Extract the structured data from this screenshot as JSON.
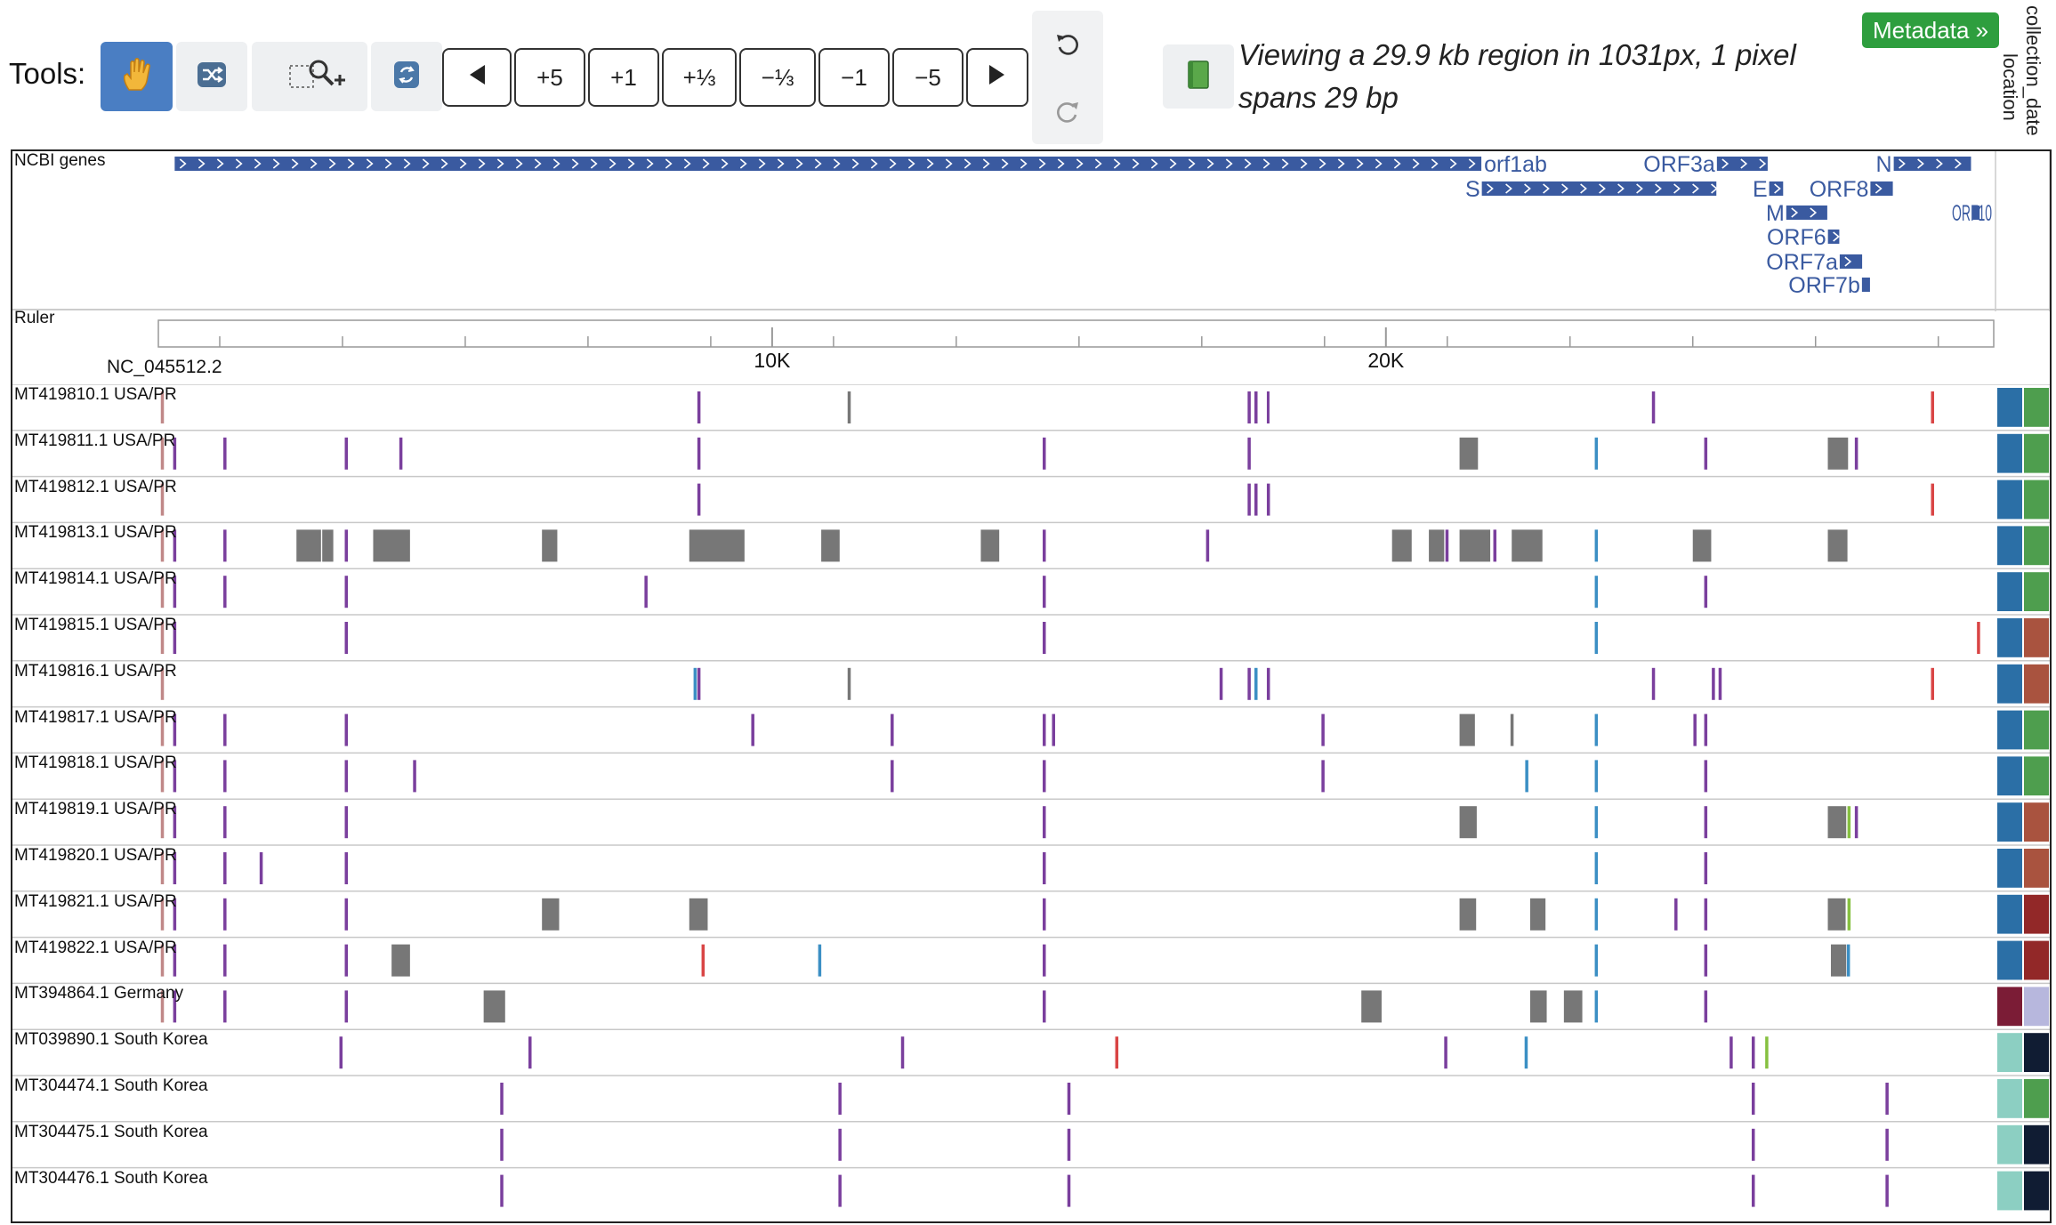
{
  "toolbar": {
    "tools_label": "Tools:",
    "icons": [
      "hand-pan-icon",
      "shuffle-icon",
      "zoom-select-icon",
      "sync-icon"
    ],
    "nav_buttons": [
      "+5",
      "+1",
      "+⅓",
      "−⅓",
      "−1",
      "−5"
    ],
    "view_info": "Viewing a 29.9 kb region in 1031px, 1 pixel spans 29 bp",
    "metadata_button": "Metadata »"
  },
  "metadata_columns": [
    "location",
    "collection_date"
  ],
  "colors": {
    "gene": "#3a5aa0",
    "purple": "#7a3f9d",
    "gray": "#777777",
    "pink": "#c08888",
    "blue": "#3b8fc4",
    "red": "#d94545",
    "green": "#86c040",
    "meta_blue": "#2b6fa6",
    "meta_green": "#4e9e4e",
    "meta_brick": "#a9533f",
    "meta_darkred": "#922828",
    "meta_maroon": "#7b1c36",
    "meta_lavender": "#b7b7dd",
    "meta_teal": "#8ccfc2",
    "meta_navy": "#101c33"
  },
  "genes_track": {
    "label": "NCBI genes",
    "genes": [
      {
        "name": "orf1ab",
        "start": 266,
        "end": 21555,
        "lane": 0
      },
      {
        "name": "ORF3a",
        "start": 25393,
        "end": 26220,
        "lane": 0
      },
      {
        "name": "N",
        "start": 28274,
        "end": 29533,
        "lane": 0
      },
      {
        "name": "S",
        "start": 21563,
        "end": 25384,
        "lane": 1
      },
      {
        "name": "E",
        "start": 26245,
        "end": 26472,
        "lane": 1
      },
      {
        "name": "ORF8",
        "start": 27894,
        "end": 28259,
        "lane": 1
      },
      {
        "name": "M",
        "start": 26523,
        "end": 27191,
        "lane": 2
      },
      {
        "name": "ORF10",
        "start": 29558,
        "end": 29674,
        "lane": 2
      },
      {
        "name": "ORF6",
        "start": 27202,
        "end": 27387,
        "lane": 3
      },
      {
        "name": "ORF7a",
        "start": 27394,
        "end": 27759,
        "lane": 4
      },
      {
        "name": "ORF7b",
        "start": 27756,
        "end": 27887,
        "lane": 5
      }
    ]
  },
  "ruler_track": {
    "label": "Ruler",
    "reference": "NC_045512.2",
    "major_ticks": [
      "10K",
      "20K"
    ],
    "major_tick_values": [
      10000,
      20000
    ],
    "region_bp": [
      0,
      29903
    ]
  },
  "sequences": [
    {
      "label": "MT419810.1 USA/PR",
      "meta": [
        "meta_blue",
        "meta_green"
      ],
      "marks": [
        {
          "p": 40,
          "c": "pink"
        },
        {
          "p": 8782,
          "c": "purple"
        },
        {
          "p": 11230,
          "c": "gray"
        },
        {
          "p": 17747,
          "c": "purple"
        },
        {
          "p": 17858,
          "c": "purple"
        },
        {
          "p": 18060,
          "c": "purple",
          "w": 3
        },
        {
          "p": 24334,
          "c": "purple"
        },
        {
          "p": 28881,
          "c": "red"
        }
      ]
    },
    {
      "label": "MT419811.1 USA/PR",
      "meta": [
        "meta_blue",
        "meta_green"
      ],
      "marks": [
        {
          "p": 40,
          "c": "pink"
        },
        {
          "p": 241,
          "c": "purple"
        },
        {
          "p": 1059,
          "c": "purple"
        },
        {
          "p": 3037,
          "c": "purple"
        },
        {
          "p": 3926,
          "c": "purple"
        },
        {
          "p": 8782,
          "c": "purple"
        },
        {
          "p": 14408,
          "c": "purple"
        },
        {
          "p": 17747,
          "c": "purple"
        },
        {
          "p": 21200,
          "c": "gray",
          "e": 21500
        },
        {
          "p": 23403,
          "c": "blue"
        },
        {
          "p": 25186,
          "c": "purple"
        },
        {
          "p": 27200,
          "c": "gray",
          "e": 27530
        },
        {
          "p": 27640,
          "c": "purple"
        }
      ]
    },
    {
      "label": "MT419812.1 USA/PR",
      "meta": [
        "meta_blue",
        "meta_green"
      ],
      "marks": [
        {
          "p": 40,
          "c": "pink"
        },
        {
          "p": 8782,
          "c": "purple"
        },
        {
          "p": 17747,
          "c": "purple"
        },
        {
          "p": 17858,
          "c": "purple"
        },
        {
          "p": 18060,
          "c": "purple"
        },
        {
          "p": 28881,
          "c": "red"
        }
      ]
    },
    {
      "label": "MT419813.1 USA/PR",
      "meta": [
        "meta_blue",
        "meta_green"
      ],
      "marks": [
        {
          "p": 40,
          "c": "pink"
        },
        {
          "p": 241,
          "c": "purple"
        },
        {
          "p": 1059,
          "c": "purple"
        },
        {
          "p": 2250,
          "c": "gray",
          "e": 2650
        },
        {
          "p": 2670,
          "c": "gray",
          "e": 2850
        },
        {
          "p": 3037,
          "c": "purple"
        },
        {
          "p": 3500,
          "c": "gray",
          "e": 4100
        },
        {
          "p": 6250,
          "c": "gray",
          "e": 6500
        },
        {
          "p": 8650,
          "c": "gray",
          "e": 9550
        },
        {
          "p": 10800,
          "c": "gray",
          "e": 11100
        },
        {
          "p": 13400,
          "c": "gray",
          "e": 13700
        },
        {
          "p": 14408,
          "c": "purple"
        },
        {
          "p": 17070,
          "c": "purple"
        },
        {
          "p": 20100,
          "c": "gray",
          "e": 20420
        },
        {
          "p": 20700,
          "c": "gray",
          "e": 20950
        },
        {
          "p": 20970,
          "c": "purple"
        },
        {
          "p": 21200,
          "c": "gray",
          "e": 21700
        },
        {
          "p": 21750,
          "c": "purple"
        },
        {
          "p": 22050,
          "c": "gray",
          "e": 22550
        },
        {
          "p": 23403,
          "c": "blue"
        },
        {
          "p": 25000,
          "c": "gray",
          "e": 25300
        },
        {
          "p": 27200,
          "c": "gray",
          "e": 27520
        }
      ]
    },
    {
      "label": "MT419814.1 USA/PR",
      "meta": [
        "meta_blue",
        "meta_green"
      ],
      "marks": [
        {
          "p": 40,
          "c": "pink"
        },
        {
          "p": 241,
          "c": "purple"
        },
        {
          "p": 1059,
          "c": "purple"
        },
        {
          "p": 3037,
          "c": "purple"
        },
        {
          "p": 7920,
          "c": "purple"
        },
        {
          "p": 14408,
          "c": "purple"
        },
        {
          "p": 23403,
          "c": "blue"
        },
        {
          "p": 25186,
          "c": "purple"
        }
      ]
    },
    {
      "label": "MT419815.1 USA/PR",
      "meta": [
        "meta_blue",
        "meta_brick"
      ],
      "marks": [
        {
          "p": 40,
          "c": "pink"
        },
        {
          "p": 241,
          "c": "purple"
        },
        {
          "p": 3037,
          "c": "purple"
        },
        {
          "p": 14408,
          "c": "purple"
        },
        {
          "p": 23403,
          "c": "blue"
        },
        {
          "p": 29630,
          "c": "red"
        }
      ]
    },
    {
      "label": "MT419816.1 USA/PR",
      "meta": [
        "meta_blue",
        "meta_brick"
      ],
      "marks": [
        {
          "p": 40,
          "c": "pink"
        },
        {
          "p": 8720,
          "c": "blue"
        },
        {
          "p": 8782,
          "c": "purple"
        },
        {
          "p": 11230,
          "c": "gray"
        },
        {
          "p": 17290,
          "c": "purple"
        },
        {
          "p": 17747,
          "c": "purple"
        },
        {
          "p": 17858,
          "c": "blue"
        },
        {
          "p": 18060,
          "c": "purple"
        },
        {
          "p": 24334,
          "c": "purple"
        },
        {
          "p": 25310,
          "c": "purple"
        },
        {
          "p": 25420,
          "c": "purple"
        },
        {
          "p": 28881,
          "c": "red"
        }
      ]
    },
    {
      "label": "MT419817.1 USA/PR",
      "meta": [
        "meta_blue",
        "meta_green"
      ],
      "marks": [
        {
          "p": 40,
          "c": "pink"
        },
        {
          "p": 241,
          "c": "purple"
        },
        {
          "p": 1059,
          "c": "purple"
        },
        {
          "p": 3037,
          "c": "purple"
        },
        {
          "p": 9660,
          "c": "purple"
        },
        {
          "p": 11930,
          "c": "purple"
        },
        {
          "p": 14408,
          "c": "purple"
        },
        {
          "p": 14560,
          "c": "purple"
        },
        {
          "p": 18950,
          "c": "purple"
        },
        {
          "p": 21200,
          "c": "gray",
          "e": 21450
        },
        {
          "p": 22030,
          "c": "gray"
        },
        {
          "p": 23403,
          "c": "blue"
        },
        {
          "p": 25010,
          "c": "purple"
        },
        {
          "p": 25186,
          "c": "purple"
        }
      ]
    },
    {
      "label": "MT419818.1 USA/PR",
      "meta": [
        "meta_blue",
        "meta_green"
      ],
      "marks": [
        {
          "p": 40,
          "c": "pink"
        },
        {
          "p": 241,
          "c": "purple"
        },
        {
          "p": 1059,
          "c": "purple"
        },
        {
          "p": 3037,
          "c": "purple"
        },
        {
          "p": 4150,
          "c": "purple"
        },
        {
          "p": 11930,
          "c": "purple"
        },
        {
          "p": 14408,
          "c": "purple"
        },
        {
          "p": 18950,
          "c": "purple"
        },
        {
          "p": 22270,
          "c": "blue"
        },
        {
          "p": 23403,
          "c": "blue"
        },
        {
          "p": 25186,
          "c": "purple"
        }
      ]
    },
    {
      "label": "MT419819.1 USA/PR",
      "meta": [
        "meta_blue",
        "meta_brick"
      ],
      "marks": [
        {
          "p": 40,
          "c": "pink"
        },
        {
          "p": 241,
          "c": "purple"
        },
        {
          "p": 1059,
          "c": "purple"
        },
        {
          "p": 3037,
          "c": "purple"
        },
        {
          "p": 14408,
          "c": "purple"
        },
        {
          "p": 21200,
          "c": "gray",
          "e": 21480
        },
        {
          "p": 23403,
          "c": "blue"
        },
        {
          "p": 25186,
          "c": "purple"
        },
        {
          "p": 27200,
          "c": "gray",
          "e": 27500
        },
        {
          "p": 27520,
          "c": "green"
        },
        {
          "p": 27640,
          "c": "purple"
        }
      ]
    },
    {
      "label": "MT419820.1 USA/PR",
      "meta": [
        "meta_blue",
        "meta_brick"
      ],
      "marks": [
        {
          "p": 40,
          "c": "pink"
        },
        {
          "p": 241,
          "c": "purple"
        },
        {
          "p": 1059,
          "c": "purple"
        },
        {
          "p": 1650,
          "c": "purple"
        },
        {
          "p": 3037,
          "c": "purple"
        },
        {
          "p": 14408,
          "c": "purple"
        },
        {
          "p": 23403,
          "c": "blue"
        },
        {
          "p": 25186,
          "c": "purple"
        }
      ]
    },
    {
      "label": "MT419821.1 USA/PR",
      "meta": [
        "meta_blue",
        "meta_darkred"
      ],
      "marks": [
        {
          "p": 40,
          "c": "pink"
        },
        {
          "p": 241,
          "c": "purple"
        },
        {
          "p": 1059,
          "c": "purple"
        },
        {
          "p": 3037,
          "c": "purple"
        },
        {
          "p": 6250,
          "c": "gray",
          "e": 6530
        },
        {
          "p": 8650,
          "c": "gray",
          "e": 8950
        },
        {
          "p": 14408,
          "c": "purple"
        },
        {
          "p": 21200,
          "c": "gray",
          "e": 21470
        },
        {
          "p": 22350,
          "c": "gray",
          "e": 22600
        },
        {
          "p": 23403,
          "c": "blue"
        },
        {
          "p": 24700,
          "c": "purple"
        },
        {
          "p": 25186,
          "c": "purple"
        },
        {
          "p": 27200,
          "c": "gray",
          "e": 27490
        },
        {
          "p": 27520,
          "c": "green"
        }
      ]
    },
    {
      "label": "MT419822.1 USA/PR",
      "meta": [
        "meta_blue",
        "meta_darkred"
      ],
      "marks": [
        {
          "p": 40,
          "c": "pink"
        },
        {
          "p": 241,
          "c": "purple"
        },
        {
          "p": 1059,
          "c": "purple"
        },
        {
          "p": 3037,
          "c": "purple"
        },
        {
          "p": 3800,
          "c": "gray",
          "e": 4100
        },
        {
          "p": 8850,
          "c": "red"
        },
        {
          "p": 10750,
          "c": "blue"
        },
        {
          "p": 14408,
          "c": "purple"
        },
        {
          "p": 23403,
          "c": "blue"
        },
        {
          "p": 25186,
          "c": "purple"
        },
        {
          "p": 27250,
          "c": "gray",
          "e": 27500
        },
        {
          "p": 27510,
          "c": "blue"
        }
      ]
    },
    {
      "label": "MT394864.1 Germany",
      "meta": [
        "meta_maroon",
        "meta_lavender"
      ],
      "marks": [
        {
          "p": 40,
          "c": "pink"
        },
        {
          "p": 241,
          "c": "purple"
        },
        {
          "p": 1059,
          "c": "purple"
        },
        {
          "p": 3037,
          "c": "purple"
        },
        {
          "p": 5300,
          "c": "gray",
          "e": 5650
        },
        {
          "p": 14408,
          "c": "purple"
        },
        {
          "p": 19600,
          "c": "gray",
          "e": 19930
        },
        {
          "p": 22350,
          "c": "gray",
          "e": 22620
        },
        {
          "p": 22900,
          "c": "gray",
          "e": 23200
        },
        {
          "p": 23403,
          "c": "blue"
        },
        {
          "p": 25186,
          "c": "purple"
        }
      ]
    },
    {
      "label": "MT039890.1 South Korea",
      "meta": [
        "meta_teal",
        "meta_navy"
      ],
      "marks": [
        {
          "p": 2950,
          "c": "purple"
        },
        {
          "p": 6030,
          "c": "purple"
        },
        {
          "p": 12100,
          "c": "purple"
        },
        {
          "p": 15590,
          "c": "red"
        },
        {
          "p": 20950,
          "c": "purple"
        },
        {
          "p": 22260,
          "c": "blue"
        },
        {
          "p": 25600,
          "c": "purple"
        },
        {
          "p": 25960,
          "c": "purple"
        },
        {
          "p": 26180,
          "c": "green"
        }
      ]
    },
    {
      "label": "MT304474.1 South Korea",
      "meta": [
        "meta_teal",
        "meta_green"
      ],
      "marks": [
        {
          "p": 5570,
          "c": "purple"
        },
        {
          "p": 11080,
          "c": "purple"
        },
        {
          "p": 14810,
          "c": "purple"
        },
        {
          "p": 25960,
          "c": "purple"
        },
        {
          "p": 28140,
          "c": "purple"
        }
      ]
    },
    {
      "label": "MT304475.1 South Korea",
      "meta": [
        "meta_teal",
        "meta_navy"
      ],
      "marks": [
        {
          "p": 5570,
          "c": "purple"
        },
        {
          "p": 11080,
          "c": "purple"
        },
        {
          "p": 14810,
          "c": "purple"
        },
        {
          "p": 25960,
          "c": "purple"
        },
        {
          "p": 28140,
          "c": "purple"
        }
      ]
    },
    {
      "label": "MT304476.1 South Korea",
      "meta": [
        "meta_teal",
        "meta_navy"
      ],
      "marks": [
        {
          "p": 5570,
          "c": "purple"
        },
        {
          "p": 11080,
          "c": "purple"
        },
        {
          "p": 14810,
          "c": "purple"
        },
        {
          "p": 25960,
          "c": "purple"
        },
        {
          "p": 28140,
          "c": "purple"
        }
      ]
    }
  ]
}
